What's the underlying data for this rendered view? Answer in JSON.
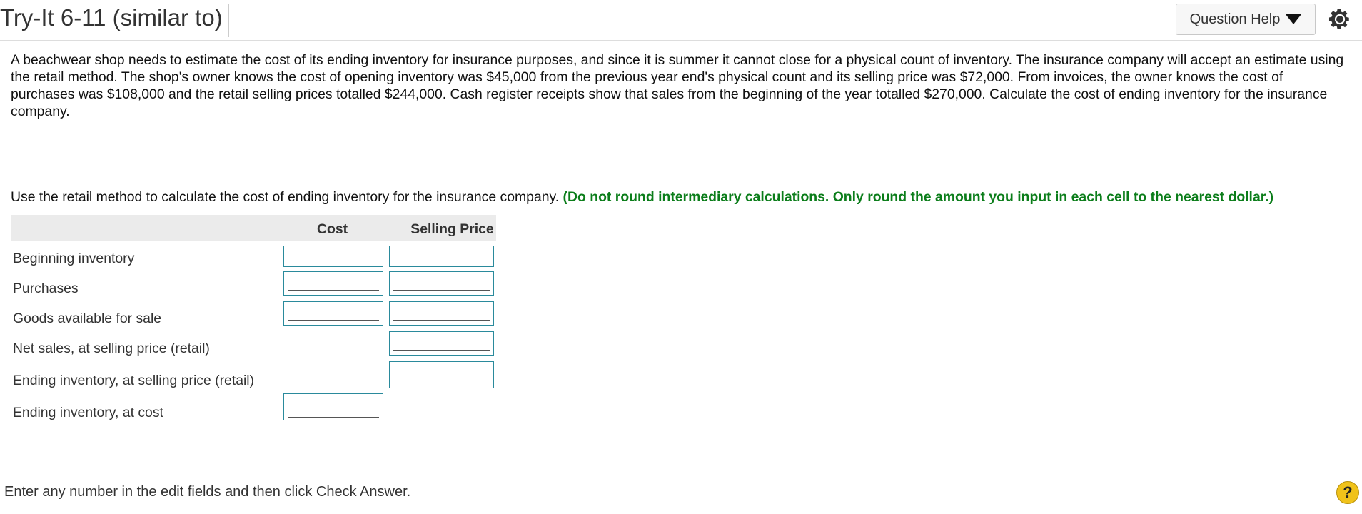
{
  "header": {
    "title": "Try-It 6-11 (similar to)",
    "question_help_label": "Question Help"
  },
  "problem_text": "A beachwear shop needs to estimate the cost of its ending inventory for insurance purposes, and since it is summer it cannot close for a physical count of inventory. The insurance company will accept an estimate using the retail method. The shop's owner knows the cost of opening inventory was $45,000 from the previous year end's physical count and its selling price was $72,000. From invoices, the owner knows the cost of purchases was $108,000 and the retail selling prices totalled $244,000. Cash register receipts show that sales from the beginning of the year totalled $270,000. Calculate the cost of ending inventory for the insurance company.",
  "instruction": {
    "text": "Use the retail method to calculate the cost of ending inventory for the insurance company.",
    "note": "(Do not round intermediary calculations. Only round the amount you input in each cell to the nearest dollar.)"
  },
  "table": {
    "headers": {
      "cost": "Cost",
      "selling_price": "Selling Price"
    },
    "rows": [
      {
        "label": "Beginning inventory",
        "cost_value": "",
        "selling_value": ""
      },
      {
        "label": "Purchases",
        "cost_value": "",
        "selling_value": ""
      },
      {
        "label": "Goods available for sale",
        "cost_value": "",
        "selling_value": ""
      },
      {
        "label": "Net sales, at selling price (retail)",
        "selling_value": ""
      },
      {
        "label": "Ending inventory, at selling price (retail)",
        "selling_value": ""
      },
      {
        "label": "Ending inventory, at cost",
        "cost_value": ""
      }
    ]
  },
  "footer": {
    "status_text": "Enter any number in the edit fields and then click Check Answer.",
    "help_icon_text": "?"
  },
  "colors": {
    "note_green": "#0b7d1a",
    "input_border": "#2a8a9c",
    "help_yellow": "#f0c21a"
  },
  "icons": {
    "settings": "gear-icon",
    "dropdown": "triangle-down-icon",
    "help": "question-mark-icon"
  }
}
